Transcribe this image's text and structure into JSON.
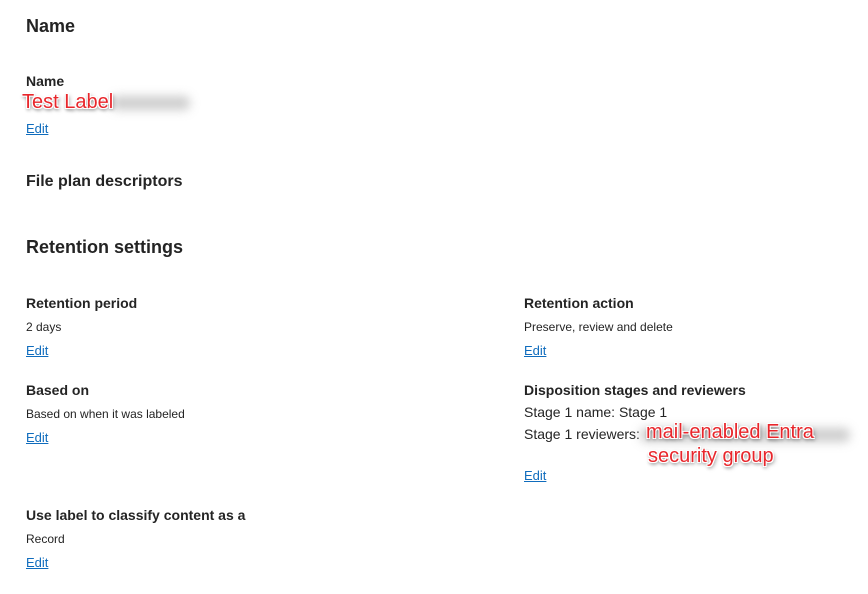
{
  "name_section": {
    "heading": "Name",
    "name_label": "Name",
    "name_annotation": "Test Label",
    "edit_label": "Edit"
  },
  "file_plan": {
    "heading": "File plan descriptors"
  },
  "retention_settings": {
    "heading": "Retention settings",
    "retention_period": {
      "label": "Retention period",
      "value": "2 days",
      "edit_label": "Edit"
    },
    "retention_action": {
      "label": "Retention action",
      "value": "Preserve, review and delete",
      "edit_label": "Edit"
    },
    "based_on": {
      "label": "Based on",
      "value": "Based on when it was labeled",
      "edit_label": "Edit"
    },
    "disposition": {
      "label": "Disposition stages and reviewers",
      "stage_name": "Stage 1 name: Stage 1",
      "stage_reviewers": "Stage 1 reviewers:",
      "reviewers_annotation_line1": "mail-enabled Entra",
      "reviewers_annotation_line2": "security group",
      "edit_label": "Edit"
    },
    "classify": {
      "label": "Use label to classify content as a",
      "value": "Record",
      "edit_label": "Edit"
    }
  },
  "colors": {
    "link": "#0f6cbd",
    "text": "#242424",
    "annotation": "#e8262b"
  }
}
